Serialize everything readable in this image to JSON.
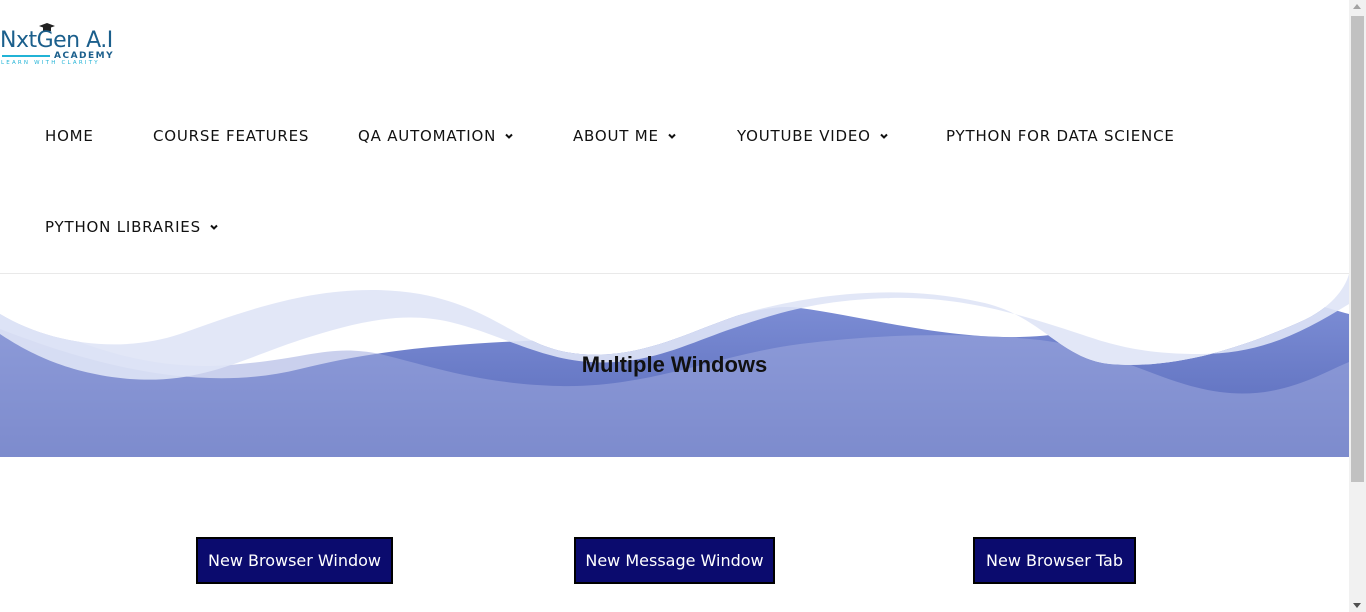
{
  "logo": {
    "main": "NxtGen A.I",
    "academy": "ACADEMY",
    "tagline": "LEARN WITH CLARITY"
  },
  "nav": {
    "items": [
      {
        "label": "HOME",
        "has_dropdown": false
      },
      {
        "label": "COURSE FEATURES",
        "has_dropdown": false
      },
      {
        "label": "QA AUTOMATION",
        "has_dropdown": true
      },
      {
        "label": "ABOUT ME",
        "has_dropdown": true
      },
      {
        "label": "YOUTUBE VIDEO",
        "has_dropdown": true
      },
      {
        "label": "PYTHON FOR DATA SCIENCE",
        "has_dropdown": false
      },
      {
        "label": "PYTHON LIBRARIES",
        "has_dropdown": true
      }
    ]
  },
  "hero": {
    "title": "Multiple Windows"
  },
  "buttons": {
    "new_browser_window": "New Browser Window",
    "new_message_window": "New Message Window",
    "new_browser_tab": "New Browser Tab"
  },
  "colors": {
    "button_bg": "#0b0b6e",
    "logo_primary": "#1b5f8c",
    "logo_accent": "#21b3d6",
    "hero_wave_dark": "#5a6cbd",
    "hero_wave_light": "#e3e7f7"
  },
  "icons": {
    "dropdown": "chevron-down-icon",
    "logo_cap": "graduation-cap-icon"
  }
}
